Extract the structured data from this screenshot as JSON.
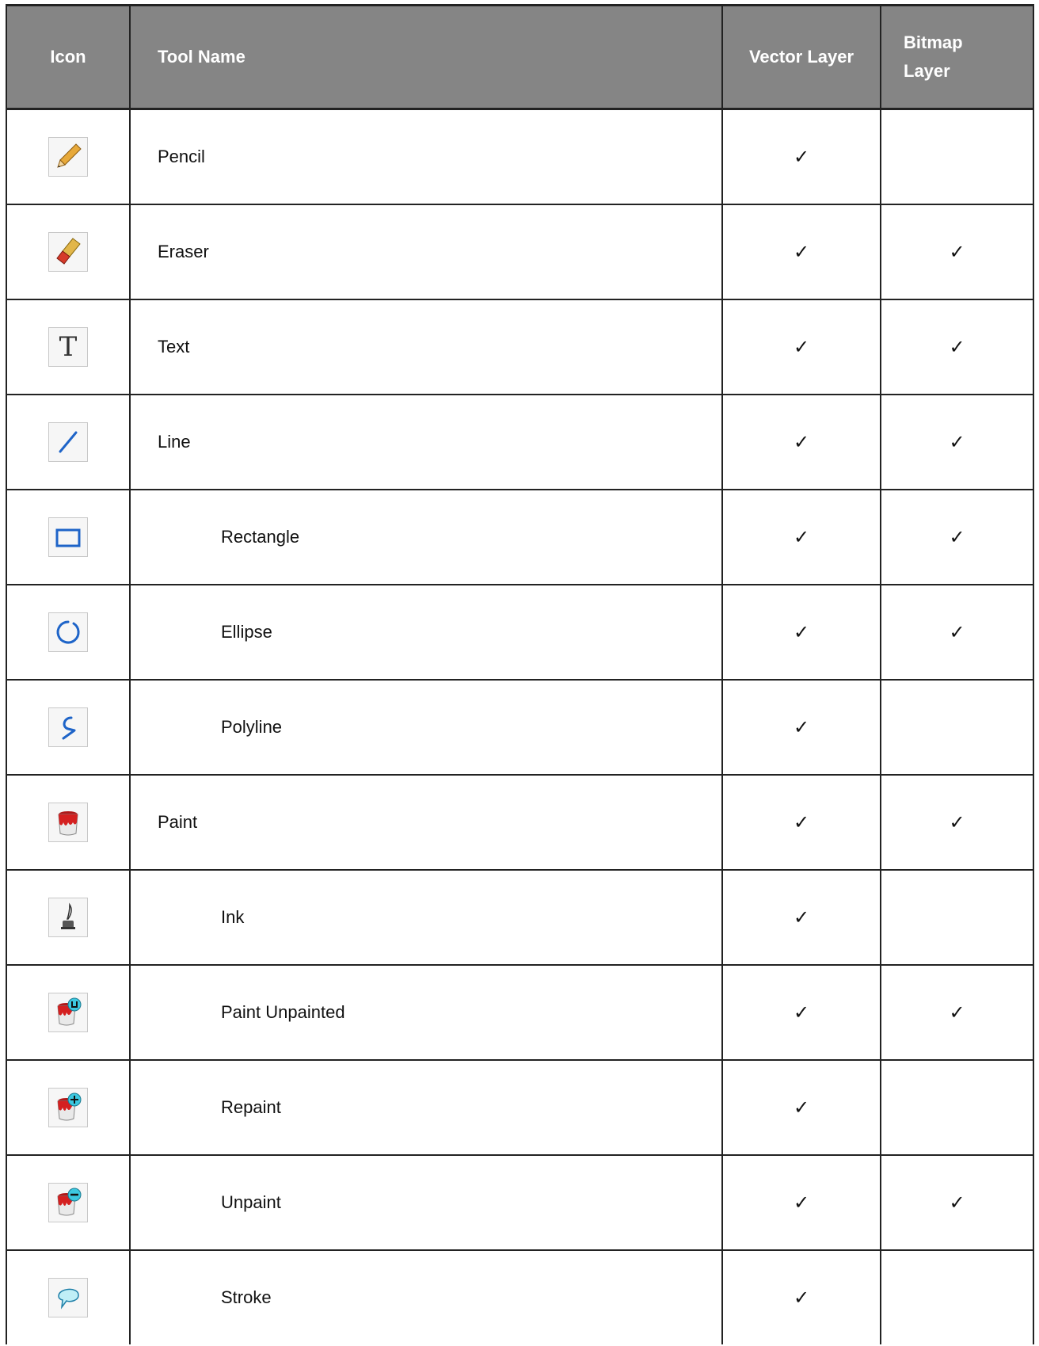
{
  "headers": {
    "icon": "Icon",
    "tool_name": "Tool Name",
    "vector_layer": "Vector Layer",
    "bitmap_layer_line1": "Bitmap",
    "bitmap_layer_line2": "Layer"
  },
  "check_glyph": "✓",
  "rows": [
    {
      "name": "Pencil",
      "icon": "pencil-icon",
      "indent": false,
      "vector": "✓",
      "bitmap": ""
    },
    {
      "name": "Eraser",
      "icon": "eraser-icon",
      "indent": false,
      "vector": "✓",
      "bitmap": "✓"
    },
    {
      "name": "Text",
      "icon": "text-icon",
      "indent": false,
      "vector": "✓",
      "bitmap": "✓"
    },
    {
      "name": "Line",
      "icon": "line-icon",
      "indent": false,
      "vector": "✓",
      "bitmap": "✓"
    },
    {
      "name": "Rectangle",
      "icon": "rectangle-icon",
      "indent": true,
      "vector": "✓",
      "bitmap": "✓"
    },
    {
      "name": "Ellipse",
      "icon": "ellipse-icon",
      "indent": true,
      "vector": "✓",
      "bitmap": "✓"
    },
    {
      "name": "Polyline",
      "icon": "polyline-icon",
      "indent": true,
      "vector": "✓",
      "bitmap": ""
    },
    {
      "name": "Paint",
      "icon": "paint-bucket-icon",
      "indent": false,
      "vector": "✓",
      "bitmap": "✓"
    },
    {
      "name": "Ink",
      "icon": "ink-icon",
      "indent": true,
      "vector": "✓",
      "bitmap": ""
    },
    {
      "name": "Paint Unpainted",
      "icon": "paint-unpainted-icon",
      "indent": true,
      "vector": "✓",
      "bitmap": "✓"
    },
    {
      "name": "Repaint",
      "icon": "repaint-icon",
      "indent": true,
      "vector": "✓",
      "bitmap": ""
    },
    {
      "name": "Unpaint",
      "icon": "unpaint-icon",
      "indent": true,
      "vector": "✓",
      "bitmap": "✓"
    },
    {
      "name": "Stroke",
      "icon": "stroke-icon",
      "indent": true,
      "vector": "✓",
      "bitmap": ""
    }
  ],
  "colors": {
    "header_bg": "#858585",
    "header_text": "#ffffff",
    "grid_line": "#222222",
    "tool_blue": "#1e64c8",
    "paint_red": "#d42020",
    "badge_cyan": "#3cc8e0"
  }
}
